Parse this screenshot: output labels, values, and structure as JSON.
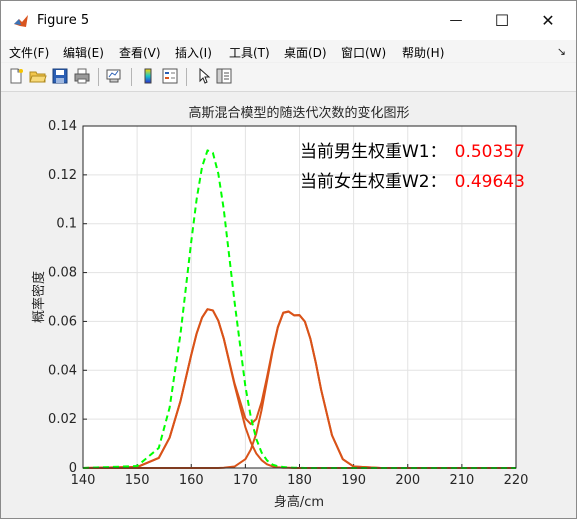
{
  "window": {
    "title": "Figure 5",
    "minimize_glyph": "—",
    "maximize_glyph": "☐",
    "close_glyph": "✕",
    "dock_glyph": "↘"
  },
  "menu": [
    "文件(F)",
    "编辑(E)",
    "查看(V)",
    "插入(I)",
    "工具(T)",
    "桌面(D)",
    "窗口(W)",
    "帮助(H)"
  ],
  "toolbar_icons": [
    "new-figure-icon",
    "open-file-icon",
    "save-icon",
    "print-icon",
    "link-plot-icon",
    "colorbar-icon",
    "legend-icon",
    "pointer-icon",
    "property-editor-icon"
  ],
  "colors": {
    "total_curve": "#00ff00",
    "component_curve": "#d95319",
    "annotation_value": "#ff0000"
  },
  "chart_data": {
    "type": "line",
    "title": "高斯混合模型的随迭代次数的变化图形",
    "xlabel": "身高/cm",
    "ylabel": "概率密度",
    "xlim": [
      140,
      220
    ],
    "ylim": [
      0,
      0.14
    ],
    "xticks": [
      "140",
      "150",
      "160",
      "170",
      "180",
      "190",
      "200",
      "210",
      "220"
    ],
    "yticks": [
      "0",
      "0.02",
      "0.04",
      "0.06",
      "0.08",
      "0.1",
      "0.12",
      "0.14"
    ],
    "grid": true,
    "x": [
      140,
      150,
      154,
      156,
      158,
      160,
      161,
      162,
      163,
      164,
      165,
      166,
      168,
      170,
      171,
      172,
      173,
      174,
      175,
      176,
      177,
      178,
      179,
      180,
      181,
      182,
      183,
      184,
      186,
      188,
      190,
      195,
      200,
      210,
      220
    ],
    "series": [
      {
        "style": "dashed",
        "color": "#00ff00",
        "values": [
          0,
          0.0008,
          0.0082,
          0.0247,
          0.0547,
          0.0927,
          0.1101,
          0.1233,
          0.13,
          0.129,
          0.1205,
          0.106,
          0.068,
          0.0334,
          0.0209,
          0.012,
          0.0063,
          0.0031,
          0.0014,
          0.0007,
          0.0004,
          0.0002,
          0.0001,
          0.0001,
          0,
          0,
          0,
          0,
          0,
          0,
          0,
          0,
          0,
          0,
          0
        ]
      },
      {
        "style": "solid",
        "color": "#d95319",
        "values": [
          0,
          0.0004,
          0.0041,
          0.0124,
          0.0273,
          0.0463,
          0.0551,
          0.0616,
          0.065,
          0.0645,
          0.0603,
          0.053,
          0.034,
          0.0167,
          0.0105,
          0.006,
          0.0032,
          0.0015,
          0.0007,
          0.0003,
          0.0001,
          0.0001,
          0,
          0,
          0,
          0,
          0,
          0,
          0,
          0,
          0,
          0,
          0,
          0,
          0
        ]
      },
      {
        "style": "solid",
        "color": "#d95319",
        "values": [
          0,
          0,
          0,
          0,
          0,
          0,
          0,
          0,
          0,
          0,
          0,
          0.0001,
          0.0006,
          0.0036,
          0.0075,
          0.014,
          0.0238,
          0.0357,
          0.0475,
          0.0575,
          0.0635,
          0.064,
          0.0625,
          0.0626,
          0.0599,
          0.053,
          0.0432,
          0.032,
          0.0134,
          0.0036,
          0.0006,
          0,
          0,
          0,
          0
        ]
      },
      {
        "style": "solid",
        "color": "#d95319",
        "values": [
          0,
          0.0004,
          0.0041,
          0.0124,
          0.0273,
          0.0463,
          0.0551,
          0.0616,
          0.065,
          0.0645,
          0.0603,
          0.0531,
          0.0346,
          0.0203,
          0.018,
          0.02,
          0.027,
          0.0372,
          0.0482,
          0.0578,
          0.0636,
          0.0641,
          0.0625,
          0.0626,
          0.0599,
          0.053,
          0.0432,
          0.032,
          0.0134,
          0.0036,
          0.0006,
          0,
          0,
          0,
          0
        ]
      }
    ],
    "annotations": [
      {
        "label": "当前男生权重W1：",
        "value": "0.50357"
      },
      {
        "label": "当前女生权重W2：",
        "value": "0.49643"
      }
    ]
  }
}
